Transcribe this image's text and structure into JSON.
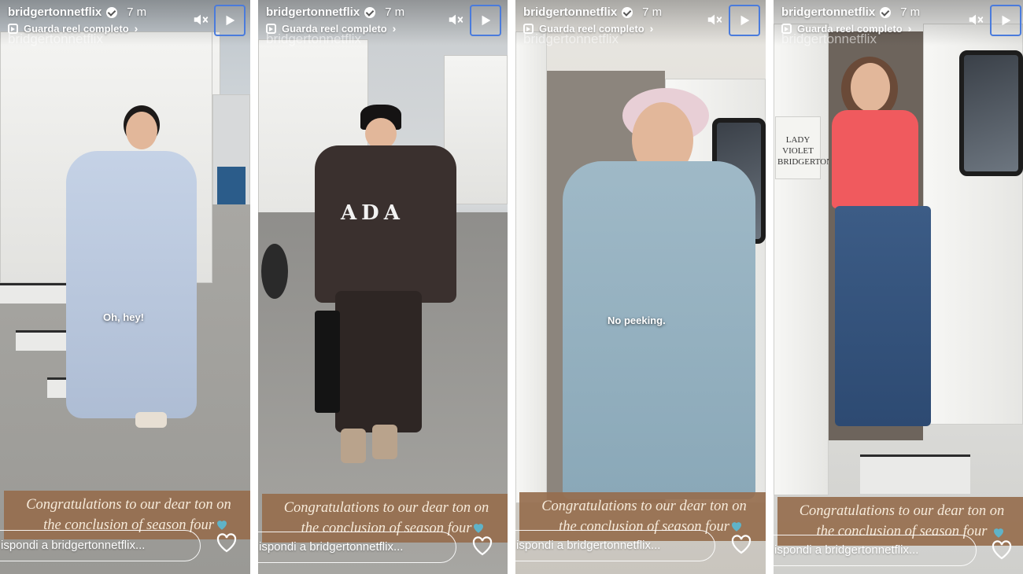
{
  "story": {
    "username": "bridgertonnetflix",
    "time_ago": "7 m",
    "reel_label": "Guarda reel completo",
    "watermark": "bridgertonnetflix",
    "banner_line1": "Congratulations to our dear ton on",
    "banner_line2": "the conclusion of season four",
    "reply_placeholder": "ispondi a bridgertonnetflix..."
  },
  "panels": [
    {
      "caption": "Oh, hey!"
    },
    {
      "caption": "",
      "shirt_text": "ADA"
    },
    {
      "caption": "No peeking."
    },
    {
      "caption": "",
      "sign_text": "LADY VIOLET BRIDGERTON"
    }
  ],
  "icons": {
    "verified": "verified-badge-icon",
    "reel": "reel-icon",
    "mute": "speaker-muted-icon",
    "play": "play-icon",
    "heart": "heart-icon",
    "banner_heart": "blue-heart-icon"
  },
  "colors": {
    "banner": "#966e4e",
    "play_border": "#4a7bdc",
    "banner_heart": "#5fb3c8"
  }
}
